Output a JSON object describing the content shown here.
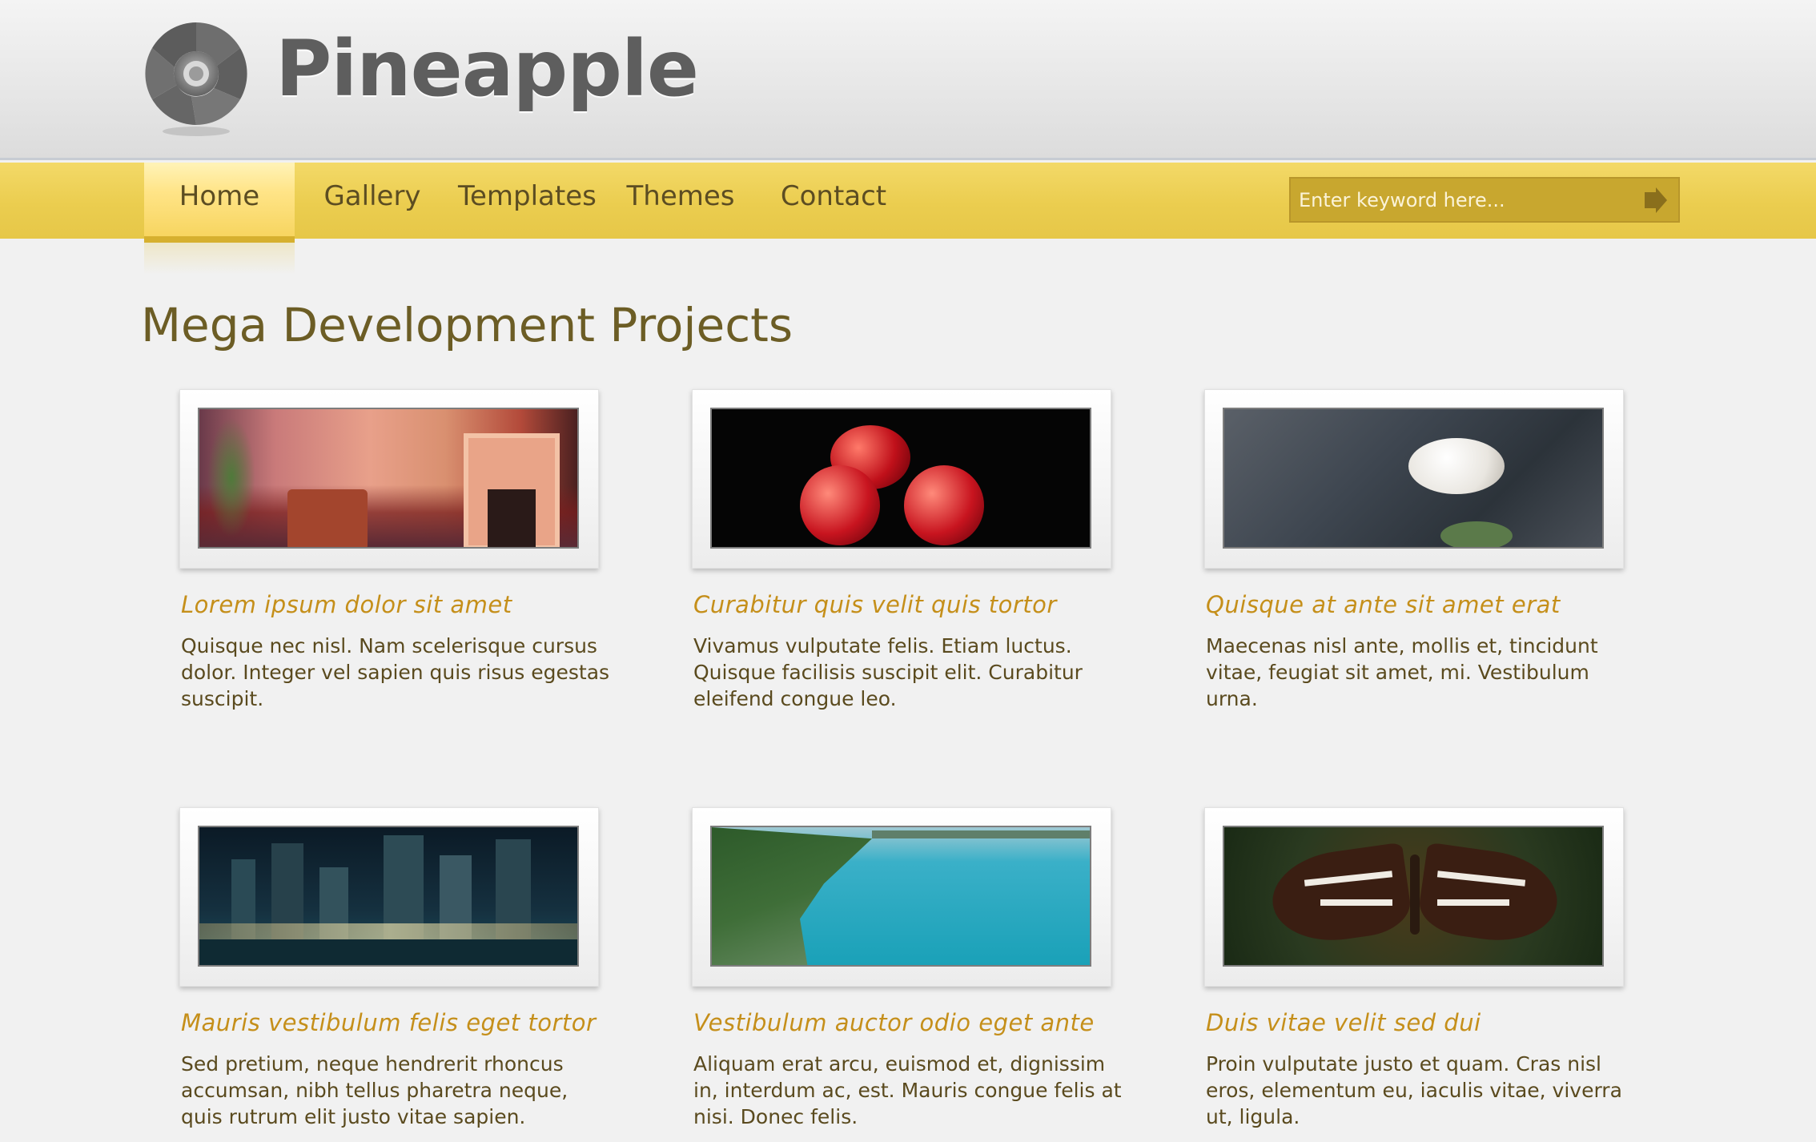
{
  "brand": {
    "name": "Pineapple",
    "logo_icon": "aperture-logo-icon"
  },
  "nav": {
    "items": [
      {
        "label": "Home",
        "active": true
      },
      {
        "label": "Gallery",
        "active": false
      },
      {
        "label": "Templates",
        "active": false
      },
      {
        "label": "Themes",
        "active": false
      },
      {
        "label": "Contact",
        "active": false
      }
    ]
  },
  "search": {
    "placeholder": "Enter keyword here...",
    "button_icon": "arrow-right-icon"
  },
  "main": {
    "title": "Mega Development Projects",
    "cards": [
      {
        "title": "Lorem ipsum dolor sit amet",
        "text": "Quisque nec nisl. Nam scelerisque cursus dolor. Integer vel sapien quis risus egestas suscipit.",
        "image": "living-room-photo"
      },
      {
        "title": "Curabitur quis velit quis tortor",
        "text": "Vivamus vulputate felis. Etiam luctus. Quisque facilisis suscipit elit. Curabitur eleifend congue leo.",
        "image": "apples-photo"
      },
      {
        "title": "Quisque at ante sit amet erat",
        "text": "Maecenas nisl ante, mollis et, tincidunt vitae, feugiat sit amet, mi. Vestibulum urna.",
        "image": "rock-stone-photo"
      },
      {
        "title": "Mauris vestibulum felis eget tortor",
        "text": "Sed pretium, neque hendrerit rhoncus accumsan, nibh tellus pharetra neque, quis rutrum elit justo vitae sapien.",
        "image": "night-city-photo"
      },
      {
        "title": "Vestibulum auctor odio eget ante",
        "text": "Aliquam erat arcu, euismod et, dignissim in, interdum ac, est. Mauris congue felis at nisi. Donec felis.",
        "image": "coastline-photo"
      },
      {
        "title": "Duis vitae velit sed dui",
        "text": "Proin vulputate justo et quam. Cras nisl eros, elementum eu, iaculis vitae, viverra ut, ligula.",
        "image": "butterfly-photo"
      }
    ]
  },
  "colors": {
    "nav_yellow": "#ebcd4f",
    "title_olive": "#6c5d25",
    "card_title_gold": "#c58f1a",
    "body_text": "#5a4a1e",
    "background": "#f1f1f1"
  }
}
